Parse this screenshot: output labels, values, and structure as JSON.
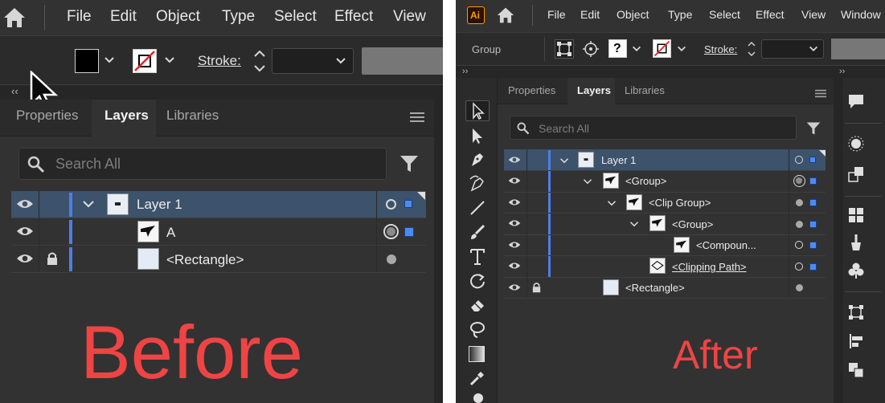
{
  "before": {
    "menu": [
      "File",
      "Edit",
      "Object",
      "Type",
      "Select",
      "Effect",
      "View"
    ],
    "stroke_label": "Stroke:",
    "collapse_glyph": "‹‹",
    "tabs": [
      "Properties",
      "Layers",
      "Libraries"
    ],
    "search_placeholder": "Search All",
    "rows": [
      "Layer 1",
      "A",
      "<Rectangle>"
    ],
    "label": "Before"
  },
  "after": {
    "app_badge": "Ai",
    "menu": [
      "File",
      "Edit",
      "Object",
      "Type",
      "Select",
      "Effect",
      "View",
      "Window"
    ],
    "context_label": "Group",
    "stroke_label": "Stroke:",
    "collapse_glyph": "››",
    "tabs": [
      "Properties",
      "Layers",
      "Libraries"
    ],
    "search_placeholder": "Search All",
    "rows": [
      "Layer 1",
      "<Group>",
      "<Clip Group>",
      "<Group>",
      "<Compoun...",
      "<Clipping Path>",
      "<Rectangle>"
    ],
    "label": "After"
  },
  "colors": {
    "accent": "#4d7ee8",
    "selected_row": "#3d526b",
    "label_red": "#ef4444"
  }
}
